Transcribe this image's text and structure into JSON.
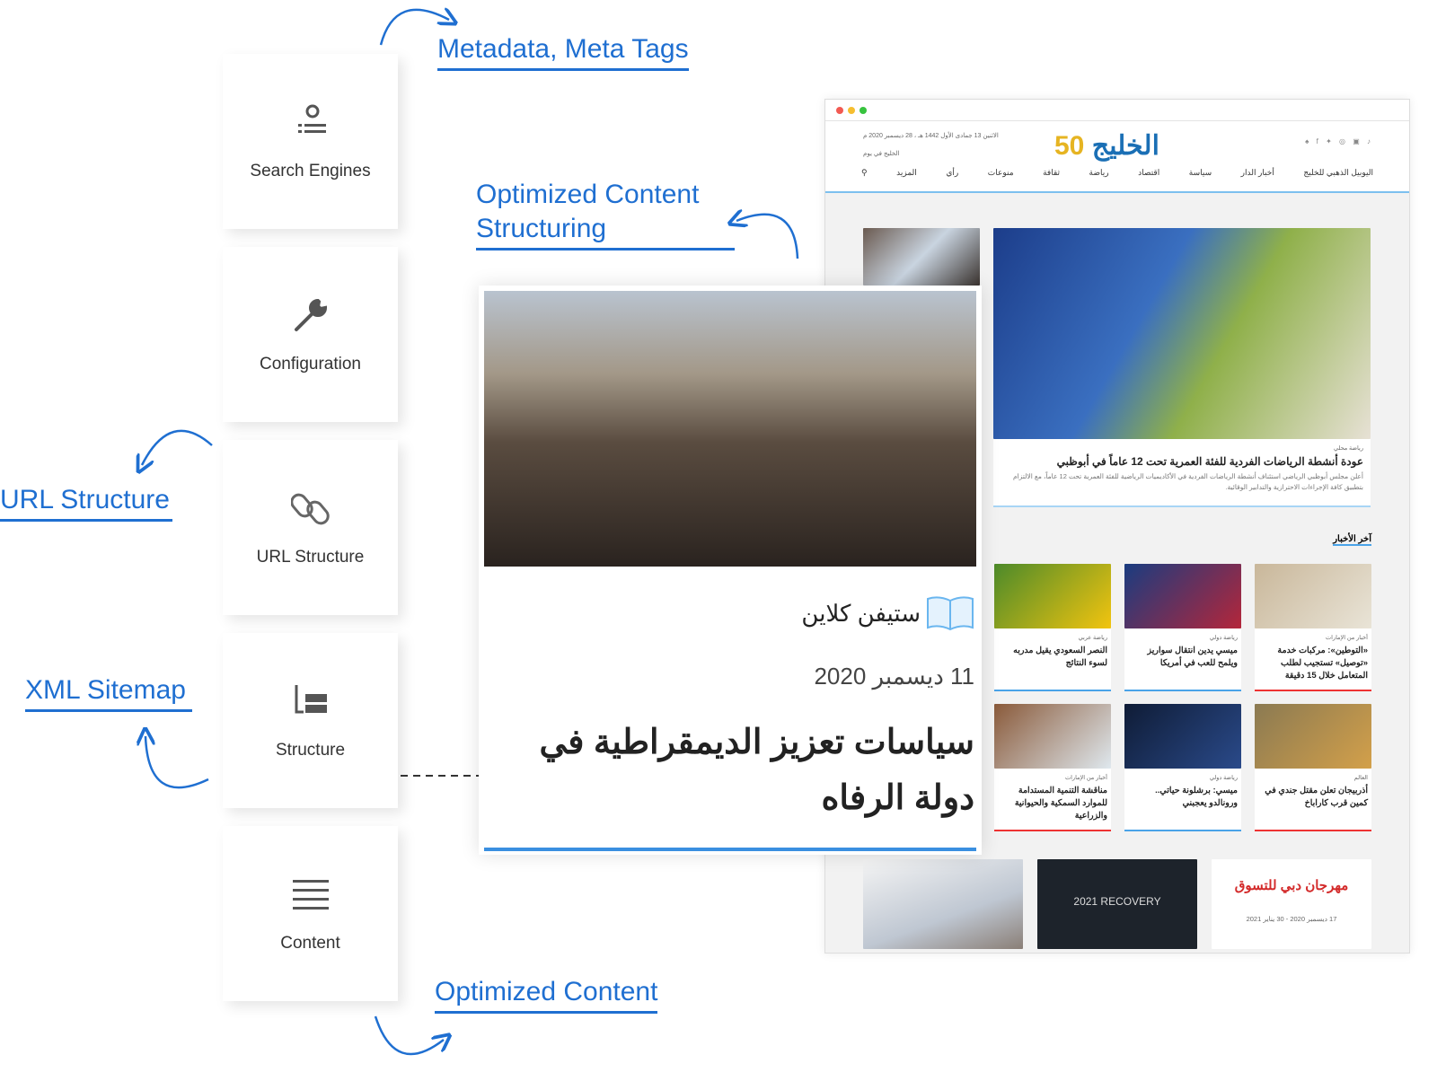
{
  "labels": {
    "metadata": "Metadata, Meta Tags",
    "optimized_structuring_1": "Optimized Content",
    "optimized_structuring_2": "Structuring",
    "url_structure": "URL Structure",
    "xml_sitemap": "XML Sitemap",
    "optimized_content": "Optimized Content"
  },
  "cards": [
    {
      "label": "Search Engines",
      "icon": "search-list-icon"
    },
    {
      "label": "Configuration",
      "icon": "wrench-icon"
    },
    {
      "label": "URL Structure",
      "icon": "link-icon"
    },
    {
      "label": "Structure",
      "icon": "hierarchy-icon"
    },
    {
      "label": "Content",
      "icon": "lines-icon"
    }
  ],
  "accent": "#1f6fd1",
  "site": {
    "logo": "الخليج 50",
    "date": "الاثنين 13 جمادى الأول 1442 هـ ، 28 ديسمبر 2020 م",
    "today": "الخليج في يوم",
    "nav": [
      "اليوبيل الذهبي للخليج",
      "أخبار الدار",
      "سياسة",
      "اقتصاد",
      "رياضة",
      "ثقافة",
      "منوعات",
      "رأي",
      "المزيد"
    ],
    "hero": {
      "category": "رياضة محلي",
      "title": "عودة أنشطة الرياضات الفردية للفئة العمرية تحت 12 عاماً في أبوظبي",
      "summary": "أعلن مجلس أبوظبي الرياضي استئناف أنشطة الرياضات الفردية في الأكاديميات الرياضية للفئة العمرية تحت 12 عاماً، مع الالتزام بتطبيق كافة الإجراءات الاحترازية والتدابير الوقائية."
    },
    "latest_heading": "آخر الأخبار",
    "news": [
      {
        "category": "أخبار من الإمارات",
        "title": "«التوطين»: مركبات خدمة «توصيل» تستجيب لطلب المتعامل خلال 15 دقيقة",
        "color": "#e33"
      },
      {
        "category": "رياضة دولي",
        "title": "ميسي يدين انتقال سواريز ويلمح للعب في أمريكا",
        "color": "#4aa3e8"
      },
      {
        "category": "رياضة عربي",
        "title": "النصر السعودي يقيل مدربه لسوء النتائج",
        "color": "#4aa3e8"
      },
      {
        "category": "العالم",
        "title": "أذربيجان تعلن مقتل جندي في كمين قرب كاراباخ",
        "color": "#e33"
      },
      {
        "category": "رياضة دولي",
        "title": "ميسي: برشلونة حياتي.. ورونالدو يعجبني",
        "color": "#4aa3e8"
      },
      {
        "category": "أخبار من الإمارات",
        "title": "مناقشة التنمية المستدامة للموارد السمكية والحيوانية والزراعية",
        "color": "#e33"
      }
    ],
    "banners": {
      "festival": "مهرجان دبي للتسوق",
      "festival_dates": "17 ديسمبر 2020 - 30 يناير 2021",
      "recovery": "2021 RECOVERY"
    }
  },
  "article": {
    "author": "ستيفن كلاين",
    "date": "11 ديسمبر 2020",
    "title": "سياسات تعزيز الديمقراطية في دولة الرفاه"
  }
}
